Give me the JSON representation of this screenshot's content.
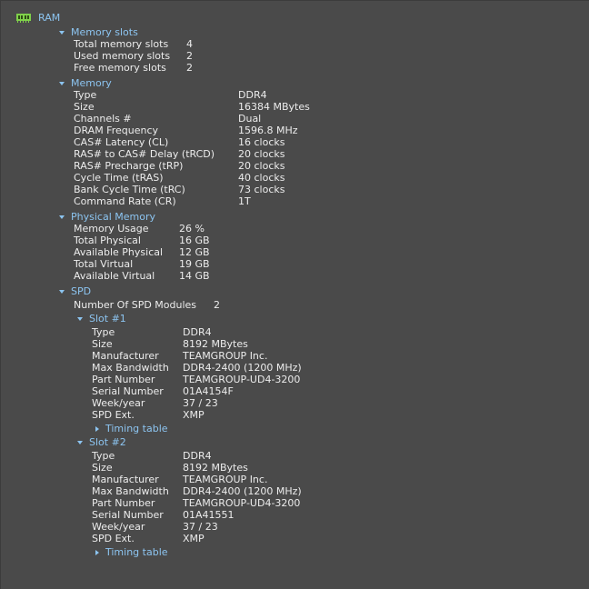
{
  "root": {
    "title": "RAM"
  },
  "memory_slots": {
    "title": "Memory slots",
    "rows": [
      {
        "label": "Total memory slots",
        "value": "4"
      },
      {
        "label": "Used memory slots",
        "value": "2"
      },
      {
        "label": "Free memory slots",
        "value": "2"
      }
    ]
  },
  "memory": {
    "title": "Memory",
    "rows": [
      {
        "label": "Type",
        "value": "DDR4"
      },
      {
        "label": "Size",
        "value": "16384 MBytes"
      },
      {
        "label": "Channels #",
        "value": "Dual"
      },
      {
        "label": "DRAM Frequency",
        "value": "1596.8 MHz"
      },
      {
        "label": "CAS# Latency (CL)",
        "value": "16 clocks"
      },
      {
        "label": "RAS# to CAS# Delay (tRCD)",
        "value": "20 clocks"
      },
      {
        "label": "RAS# Precharge (tRP)",
        "value": "20 clocks"
      },
      {
        "label": "Cycle Time (tRAS)",
        "value": "40 clocks"
      },
      {
        "label": "Bank Cycle Time (tRC)",
        "value": "73 clocks"
      },
      {
        "label": "Command Rate (CR)",
        "value": "1T"
      }
    ]
  },
  "physical_memory": {
    "title": "Physical Memory",
    "rows": [
      {
        "label": "Memory Usage",
        "value": "26 %"
      },
      {
        "label": "Total Physical",
        "value": "16 GB"
      },
      {
        "label": "Available Physical",
        "value": "12 GB"
      },
      {
        "label": "Total Virtual",
        "value": "19 GB"
      },
      {
        "label": "Available Virtual",
        "value": "14 GB"
      }
    ]
  },
  "spd": {
    "title": "SPD",
    "modules": {
      "label": "Number Of SPD Modules",
      "value": "2"
    },
    "slots": [
      {
        "title": "Slot #1",
        "rows": [
          {
            "label": "Type",
            "value": "DDR4"
          },
          {
            "label": "Size",
            "value": "8192 MBytes"
          },
          {
            "label": "Manufacturer",
            "value": "TEAMGROUP Inc."
          },
          {
            "label": "Max Bandwidth",
            "value": "DDR4-2400 (1200 MHz)"
          },
          {
            "label": "Part Number",
            "value": "TEAMGROUP-UD4-3200"
          },
          {
            "label": "Serial Number",
            "value": "01A4154F"
          },
          {
            "label": "Week/year",
            "value": "37 / 23"
          },
          {
            "label": "SPD Ext.",
            "value": "XMP"
          }
        ],
        "timing_label": "Timing table"
      },
      {
        "title": "Slot #2",
        "rows": [
          {
            "label": "Type",
            "value": "DDR4"
          },
          {
            "label": "Size",
            "value": "8192 MBytes"
          },
          {
            "label": "Manufacturer",
            "value": "TEAMGROUP Inc."
          },
          {
            "label": "Max Bandwidth",
            "value": "DDR4-2400 (1200 MHz)"
          },
          {
            "label": "Part Number",
            "value": "TEAMGROUP-UD4-3200"
          },
          {
            "label": "Serial Number",
            "value": "01A41551"
          },
          {
            "label": "Week/year",
            "value": "37 / 23"
          },
          {
            "label": "SPD Ext.",
            "value": "XMP"
          }
        ],
        "timing_label": "Timing table"
      }
    ]
  },
  "colors": {
    "background": "#4a4a4a",
    "header_accent": "#8cc4f0",
    "text": "#ececec",
    "icon": "#7fd14a"
  },
  "icons": {
    "root": "ram-chip-icon",
    "expanded": "chevron-down-icon",
    "collapsed": "chevron-right-icon"
  }
}
